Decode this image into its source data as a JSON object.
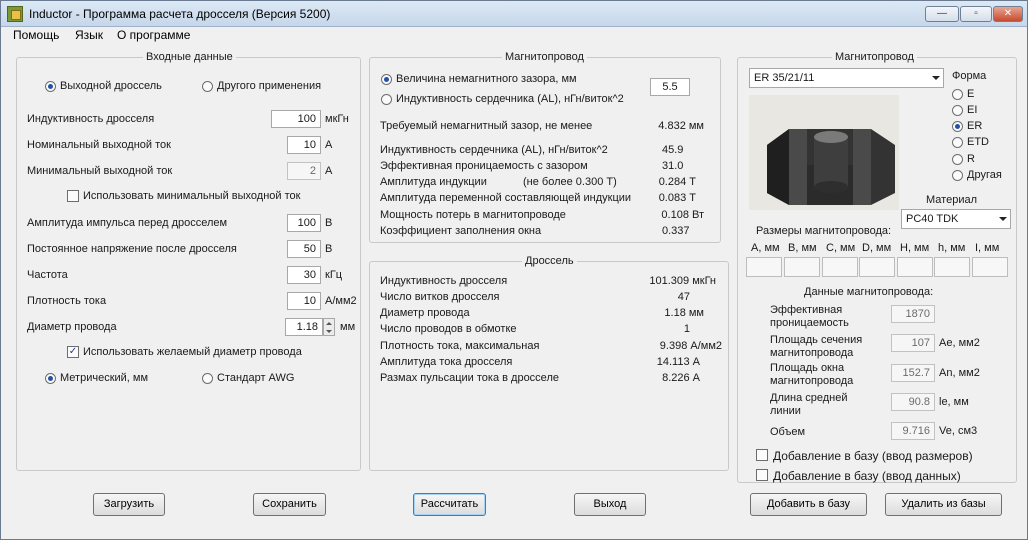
{
  "window": {
    "title": "Inductor - Программа расчета дросселя (Версия 5200)",
    "controls": [
      "—",
      "▫",
      "✕"
    ]
  },
  "menu": [
    "Помощь",
    "Язык",
    "О программе"
  ],
  "input": {
    "title": "Входные данные",
    "type_options": [
      "Выходной дроссель",
      "Другого применения"
    ],
    "type_selected": 0,
    "rows": [
      {
        "label": "Индуктивность дросселя",
        "value": "100",
        "unit": "мкГн"
      },
      {
        "label": "Номинальный выходной ток",
        "value": "10",
        "unit": "А"
      },
      {
        "label": "Минимальный выходной ток",
        "value": "2",
        "unit": "А",
        "readonly": true
      }
    ],
    "use_min_current": {
      "label": "Использовать минимальный выходной ток",
      "checked": false
    },
    "rows2": [
      {
        "label": "Амплитуда импульса перед дросселем",
        "value": "100",
        "unit": "В"
      },
      {
        "label": "Постоянное напряжение после дросселя",
        "value": "50",
        "unit": "В"
      },
      {
        "label": "Частота",
        "value": "30",
        "unit": "кГц"
      },
      {
        "label": "Плотность тока",
        "value": "10",
        "unit": "А/мм2"
      }
    ],
    "wire": {
      "label": "Диаметр провода",
      "value": "1.18",
      "unit": "мм"
    },
    "use_wire": {
      "label": "Использовать желаемый диаметр провода",
      "checked": true
    },
    "units_options": [
      "Метрический, мм",
      "Стандарт AWG"
    ],
    "units_selected": 0
  },
  "core": {
    "title": "Магнитопровод",
    "options": [
      "Величина немагнитного зазора, мм",
      "Индуктивность сердечника (AL), нГн/виток^2"
    ],
    "selected": 0,
    "gap_value": "5.5",
    "results": [
      {
        "label": "Требуемый немагнитный зазор, не менее",
        "value": "4.832 мм"
      },
      {
        "label": "Индуктивность сердечника (AL), нГн/виток^2",
        "value": "45.9"
      },
      {
        "label": "Эффективная проницаемость с зазором",
        "value": "31.0"
      },
      {
        "label": "Амплитуда индукции",
        "note": "(не более 0.300 Т)",
        "value": "0.284 Т"
      },
      {
        "label": "Амплитуда переменной составляющей индукции",
        "value": "0.083 Т"
      },
      {
        "label": "Мощность потерь в магнитопроводе",
        "value": "0.108 Вт"
      },
      {
        "label": "Коэффициент заполнения окна",
        "value": "0.337"
      }
    ]
  },
  "choke": {
    "title": "Дроссель",
    "results": [
      {
        "label": "Индуктивность дросселя",
        "value": "101.309 мкГн"
      },
      {
        "label": "Число витков дросселя",
        "value": "47"
      },
      {
        "label": "Диаметр провода",
        "value": "1.18 мм"
      },
      {
        "label": "Число проводов в обмотке",
        "value": "1"
      },
      {
        "label": "Плотность тока, максимальная",
        "value": "9.398 А/мм2"
      },
      {
        "label": "Амплитуда тока дросселя",
        "value": "14.113 А"
      },
      {
        "label": "Размах пульсации тока в дросселе",
        "value": "8.226 А"
      }
    ]
  },
  "core_db": {
    "title": "Магнитопровод",
    "core_selected": "ER 35/21/11",
    "shape_label": "Форма",
    "shapes": [
      "E",
      "EI",
      "ER",
      "ETD",
      "R",
      "Другая"
    ],
    "shape_selected": 2,
    "material_label": "Материал",
    "material": "PC40 TDK",
    "dims_label": "Размеры магнитопровода:",
    "dims": [
      "A, мм",
      "B, мм",
      "C, мм",
      "D, мм",
      "H, мм",
      "h, мм",
      "I, мм"
    ],
    "data_label": "Данные магнитопровода:",
    "params": [
      {
        "label": "Эффективная проницаемость",
        "value": "1870",
        "unit": ""
      },
      {
        "label": "Площадь сечения магнитопровода",
        "value": "107",
        "unit": "Ae, мм2"
      },
      {
        "label": "Площадь окна магнитопровода",
        "value": "152.7",
        "unit": "An, мм2"
      },
      {
        "label": "Длина средней линии",
        "value": "90.8",
        "unit": "le, мм"
      },
      {
        "label": "Объем",
        "value": "9.716",
        "unit": "Ve, см3"
      }
    ],
    "add_dims": "Добавление в базу (ввод размеров)",
    "add_data": "Добавление в базу (ввод данных)"
  },
  "buttons": {
    "load": "Загрузить",
    "save": "Сохранить",
    "calc": "Рассчитать",
    "exit": "Выход",
    "add_db": "Добавить в базу",
    "del_db": "Удалить из базы"
  }
}
